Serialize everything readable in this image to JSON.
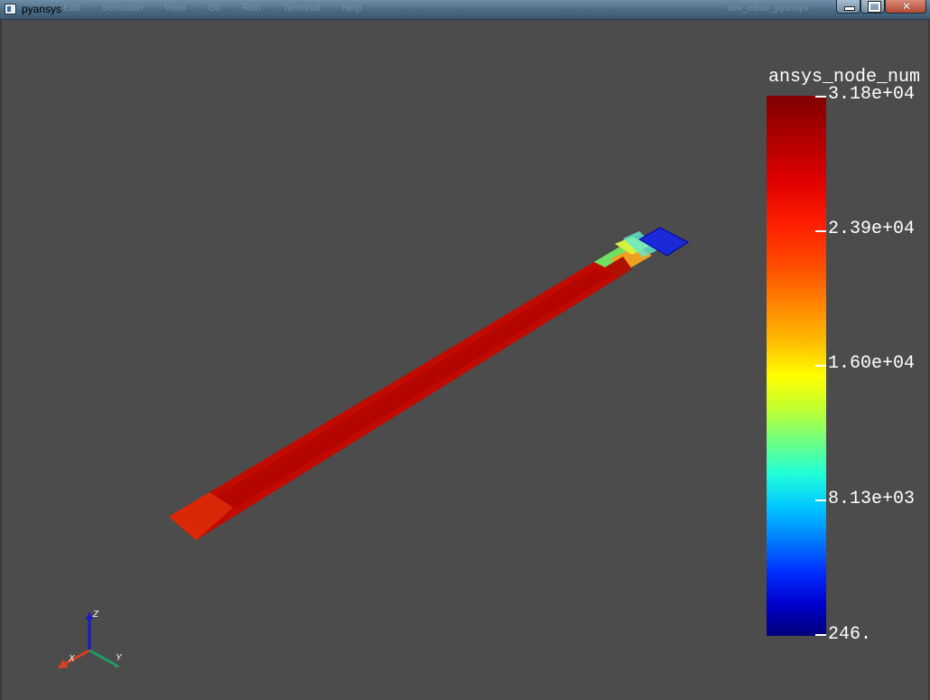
{
  "window": {
    "title": "pyansys"
  },
  "colors": {
    "background": "#4c4c4c",
    "text": "#ffffff"
  },
  "scalar_bar": {
    "title": "ansys_node_num",
    "min": 246,
    "max": 31800,
    "ticks": [
      "3.18e+04",
      "2.39e+04",
      "1.60e+04",
      "8.13e+03",
      "246."
    ]
  },
  "axes": {
    "x_label": "X",
    "y_label": "Y",
    "z_label": "Z"
  }
}
